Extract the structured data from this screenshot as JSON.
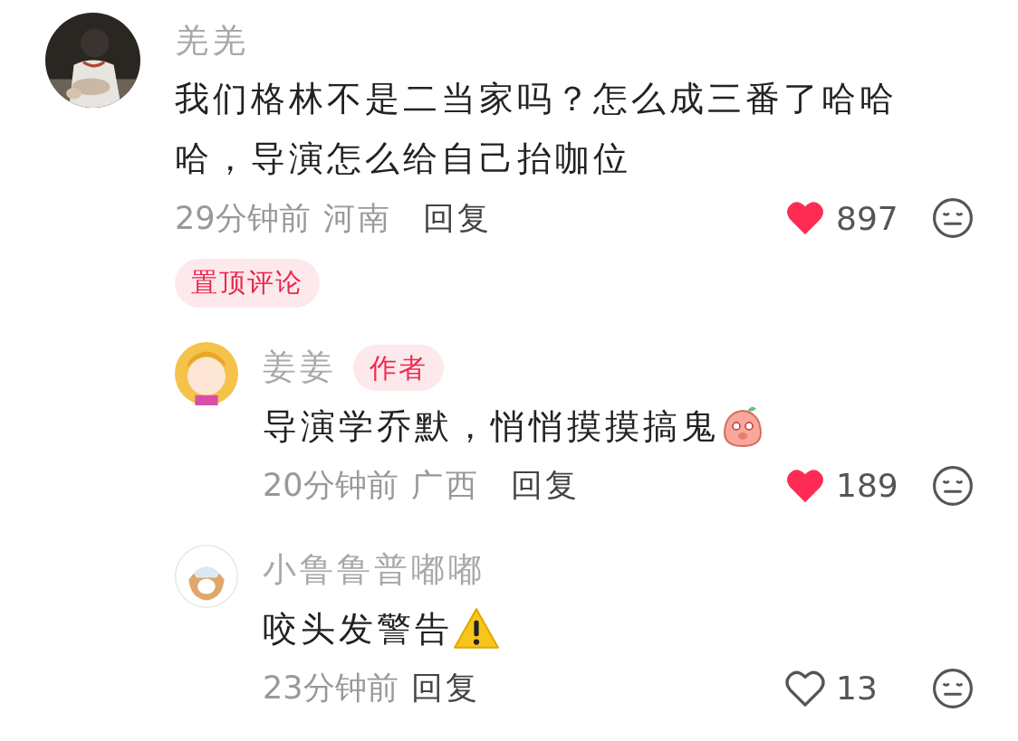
{
  "comments": [
    {
      "name": "羌羌",
      "text": "我们格林不是二当家吗？怎么成三番了哈哈哈，导演怎么给自己抬咖位",
      "time": "29分钟前",
      "location": "河南",
      "reply": "回复",
      "liked": true,
      "likes": "897",
      "pinned_tag": "置顶评论",
      "replies": [
        {
          "name": "姜姜",
          "badge": "作者",
          "avatar": {
            "kind": "girl"
          },
          "text": "导演学乔默，悄悄摸摸搞鬼",
          "emoji": {
            "kind": "sticker"
          },
          "time": "20分钟前",
          "location": "广西",
          "reply": "回复",
          "liked": true,
          "likes": "189"
        },
        {
          "name": "小鲁鲁普嘟嘟",
          "avatar": {
            "kind": "dog"
          },
          "text": "咬头发警告",
          "emoji": {
            "kind": "warning"
          },
          "time": "23分钟前",
          "reply": "回复",
          "liked": false,
          "likes": "13"
        }
      ]
    }
  ]
}
